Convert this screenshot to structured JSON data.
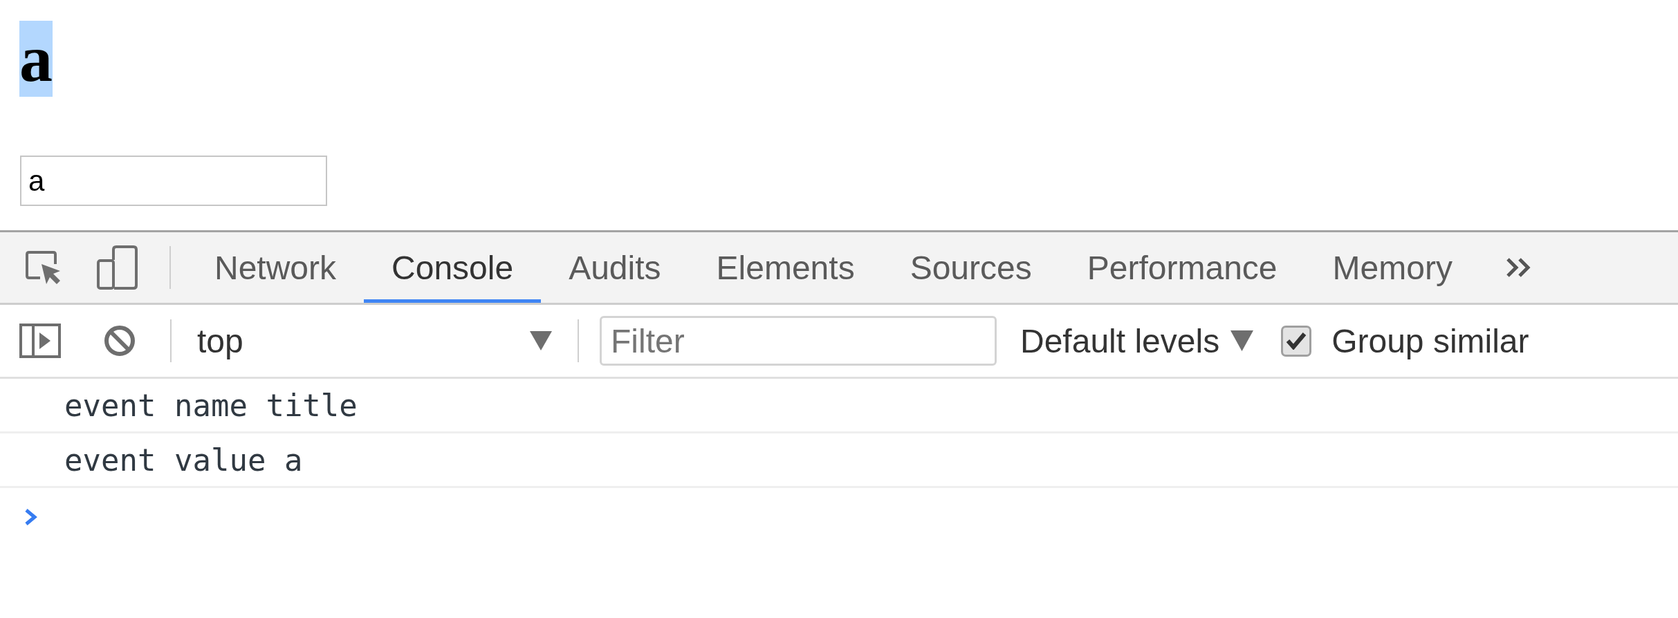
{
  "page": {
    "heading": {
      "text": "a",
      "selected": true
    },
    "text_input": {
      "value": "a"
    }
  },
  "devtools": {
    "tabs": [
      {
        "label": "Network",
        "selected": false
      },
      {
        "label": "Console",
        "selected": true
      },
      {
        "label": "Audits",
        "selected": false
      },
      {
        "label": "Elements",
        "selected": false
      },
      {
        "label": "Sources",
        "selected": false
      },
      {
        "label": "Performance",
        "selected": false
      },
      {
        "label": "Memory",
        "selected": false
      }
    ],
    "console_toolbar": {
      "context": "top",
      "filter": {
        "placeholder": "Filter"
      },
      "levels": "Default levels",
      "group_similar": {
        "label": "Group similar",
        "checked": true
      }
    },
    "messages": [
      {
        "text": "event name title"
      },
      {
        "text": "event value a"
      }
    ]
  }
}
